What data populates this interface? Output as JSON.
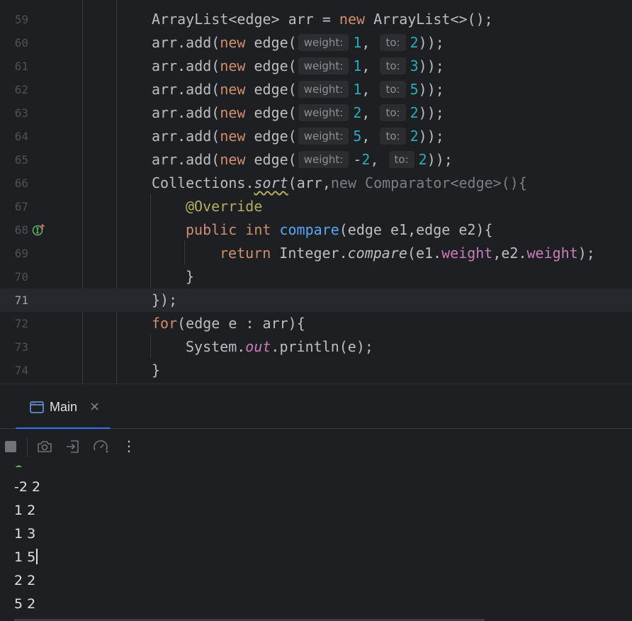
{
  "editor": {
    "lines": [
      {
        "num": "59"
      },
      {
        "num": "60"
      },
      {
        "num": "61"
      },
      {
        "num": "62"
      },
      {
        "num": "63"
      },
      {
        "num": "64"
      },
      {
        "num": "65"
      },
      {
        "num": "66"
      },
      {
        "num": "67"
      },
      {
        "num": "68"
      },
      {
        "num": "69"
      },
      {
        "num": "70"
      },
      {
        "num": "71"
      },
      {
        "num": "72"
      },
      {
        "num": "73"
      },
      {
        "num": "74"
      }
    ],
    "hints": {
      "weight": "weight:",
      "to": "to:"
    },
    "current_line": "71"
  },
  "run_panel": {
    "tab_label": "Main",
    "close_glyph": "×",
    "more_glyph": "⋮"
  },
  "console": {
    "output": [
      "-2 2",
      "1 2",
      "1 3",
      "1 5",
      "2 2",
      "5 2"
    ]
  },
  "colors": {
    "background": "#1e1f22",
    "keyword": "#cf8e6d",
    "number": "#2aacb8",
    "field": "#c77dbb",
    "method": "#56a8f5",
    "annotation": "#b3ae60",
    "accent": "#3574f0"
  }
}
